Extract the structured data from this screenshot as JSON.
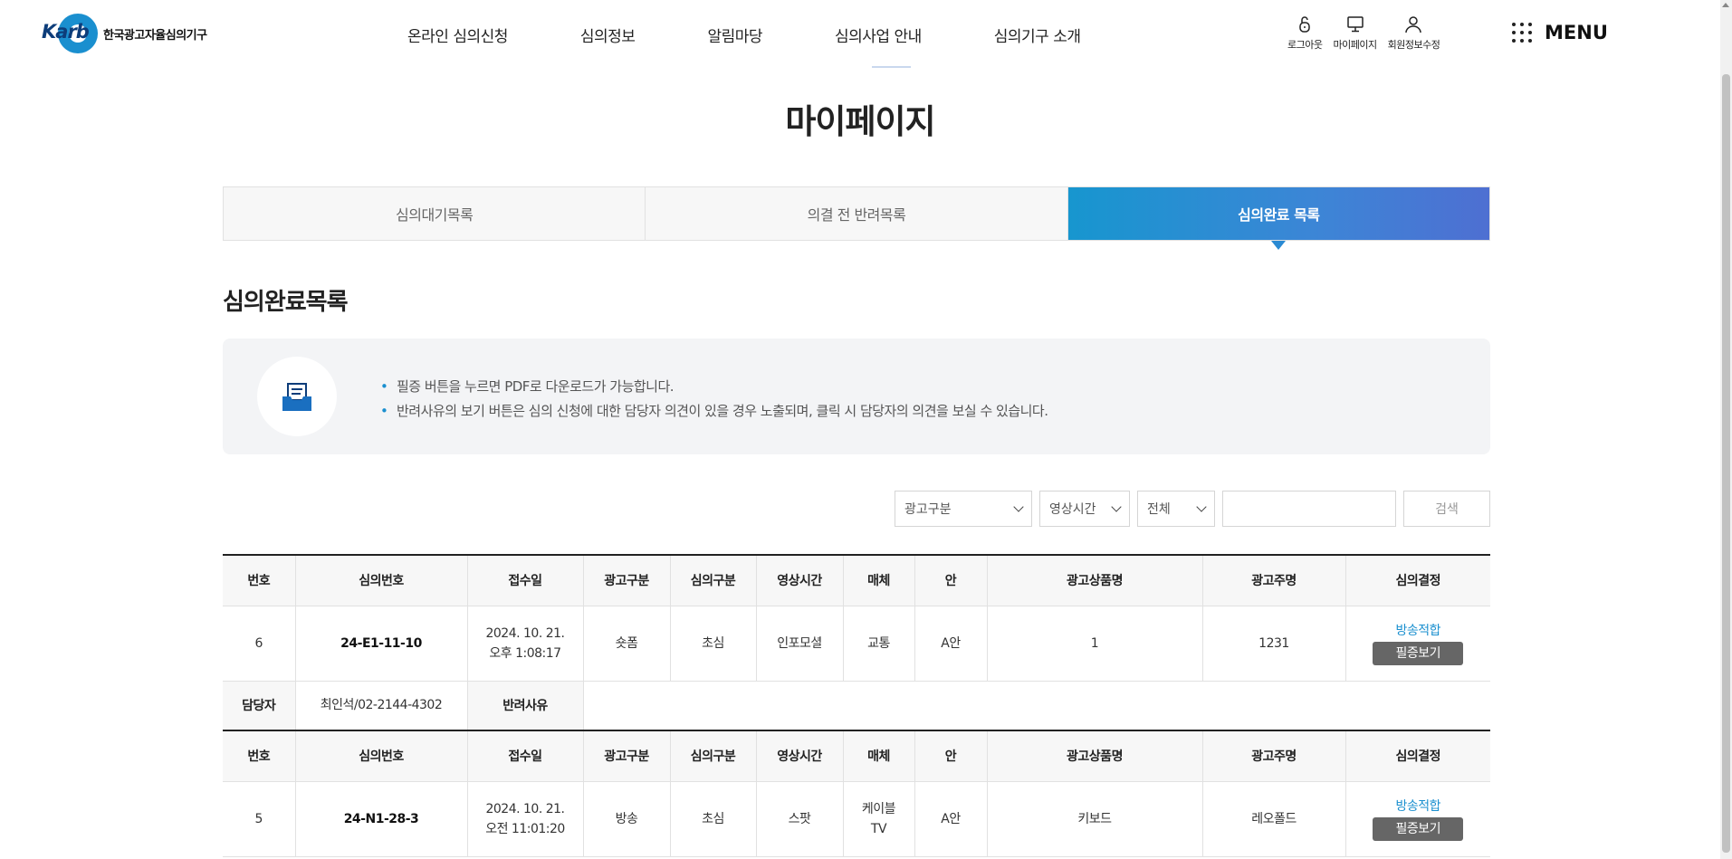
{
  "header": {
    "logo_text": "Karb",
    "logo_name": "한국광고자율심의기구",
    "gnb": [
      "온라인 심의신청",
      "심의정보",
      "알림마당",
      "심의사업 안내",
      "심의기구 소개"
    ],
    "util": [
      {
        "label": "로그아웃",
        "icon": "lock-icon"
      },
      {
        "label": "마이페이지",
        "icon": "monitor-icon"
      },
      {
        "label": "회원정보수정",
        "icon": "user-icon"
      }
    ],
    "menu_label": "MENU"
  },
  "page_title": "마이페이지",
  "tabs": [
    {
      "label": "심의대기목록",
      "active": false
    },
    {
      "label": "의결 전 반려목록",
      "active": false
    },
    {
      "label": "심의완료 목록",
      "active": true
    }
  ],
  "section_title": "심의완료목록",
  "info": [
    "필증 버튼을 누르면 PDF로 다운로드가 가능합니다.",
    "반려사유의 보기 버튼은 심의 신청에 대한 담당자 의견이 있을 경우 노출되며, 클릭 시 담당자의 의견을 보실 수 있습니다."
  ],
  "search": {
    "select1": "광고구분",
    "select2": "영상시간",
    "select3": "전체",
    "input_value": "",
    "button": "검색"
  },
  "table": {
    "headers": [
      "번호",
      "심의번호",
      "접수일",
      "광고구분",
      "심의구분",
      "영상시간",
      "매체",
      "안",
      "광고상품명",
      "광고주명",
      "심의결정"
    ],
    "manager_label": "담당자",
    "reject_label": "반려사유",
    "rows": [
      {
        "no": "6",
        "review_no": "24-E1-11-10",
        "date_line1": "2024. 10. 21.",
        "date_line2": "오후 1:08:17",
        "ad_type": "숏폼",
        "review_type": "초심",
        "duration": "인포모셜",
        "media_line1": "교통",
        "media_line2": "",
        "plan": "A안",
        "product": "1",
        "advertiser": "1231",
        "decision": "방송적합",
        "cert_button": "필증보기",
        "manager": "최인석/02-2144-4302"
      },
      {
        "no": "5",
        "review_no": "24-N1-28-3",
        "date_line1": "2024. 10. 21.",
        "date_line2": "오전 11:01:20",
        "ad_type": "방송",
        "review_type": "초심",
        "duration": "스팟",
        "media_line1": "케이블",
        "media_line2": "TV",
        "plan": "A안",
        "product": "키보드",
        "advertiser": "레오폴드",
        "decision": "방송적합",
        "cert_button": "필증보기"
      }
    ]
  },
  "colors": {
    "accent": "#1a8fcf",
    "tab_gradient_start": "#1796cf",
    "tab_gradient_end": "#4e6fd2",
    "cert_button": "#666666"
  }
}
